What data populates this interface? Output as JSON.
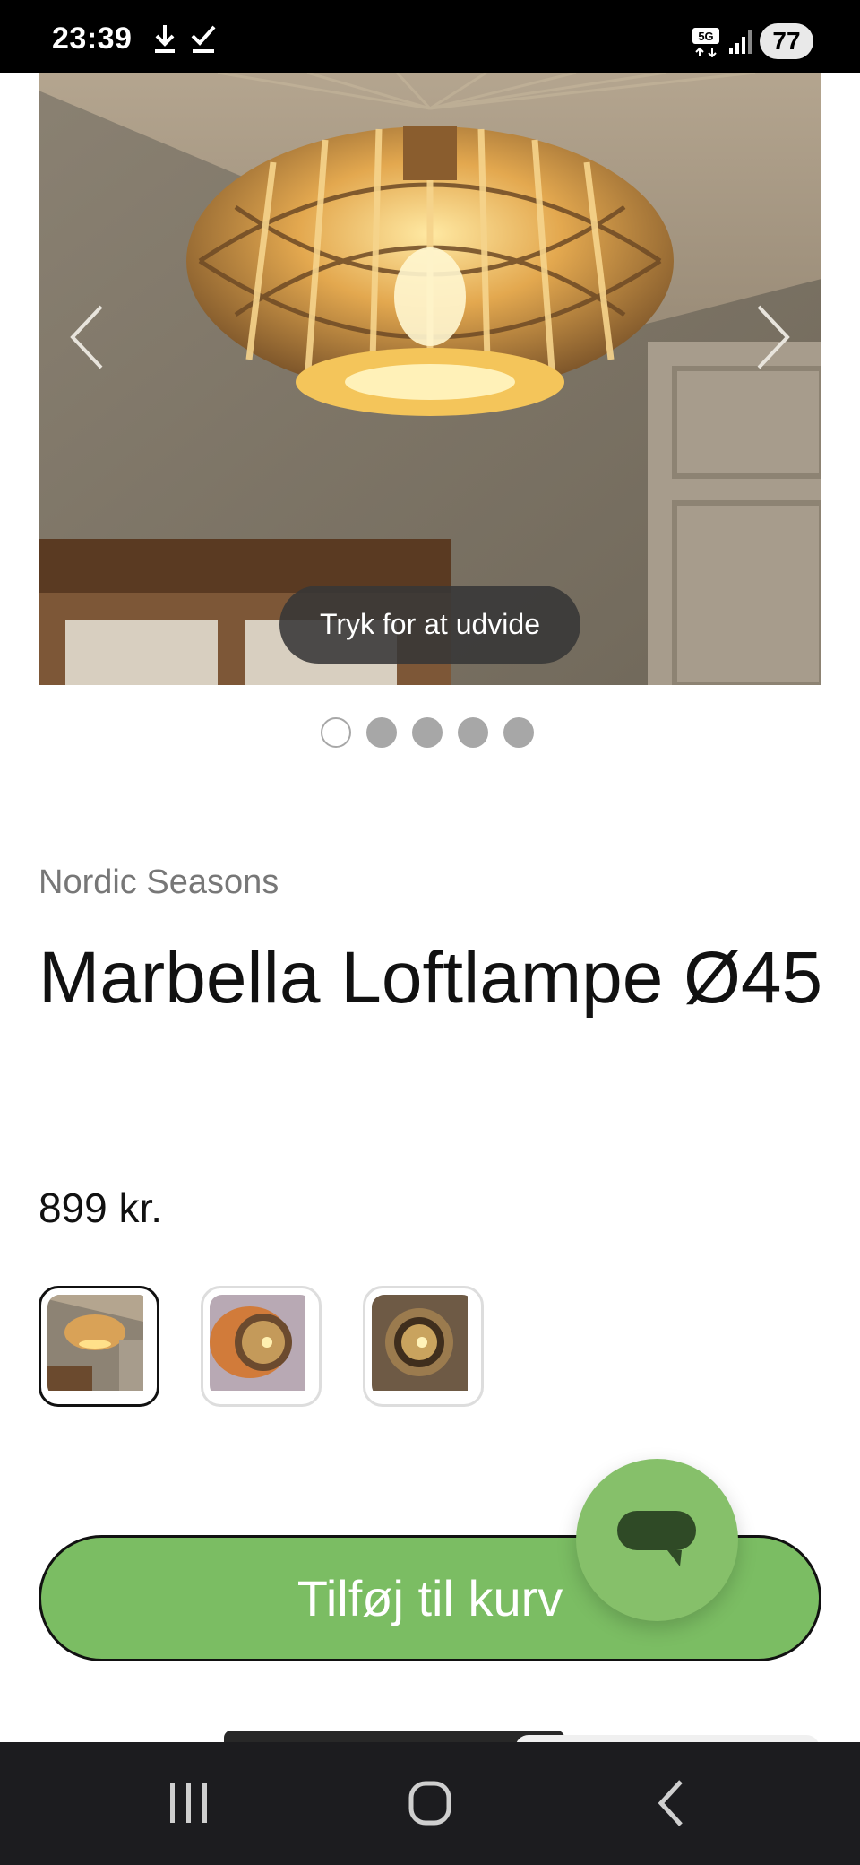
{
  "status_bar": {
    "time": "23:39",
    "network": "5G",
    "battery": "77"
  },
  "gallery": {
    "expand_hint": "Tryk for at udvide",
    "image_count": 5,
    "active_index": 0
  },
  "product": {
    "brand": "Nordic Seasons",
    "title": "Marbella Loftlampe Ø45",
    "price": "899 kr."
  },
  "variants": {
    "count": 3,
    "selected_index": 0
  },
  "cart": {
    "add_label": "Tilføj til kurv"
  },
  "colors": {
    "accent_green": "#7bbd63",
    "chat_green": "#86c06a",
    "chat_icon": "#2f4a26"
  },
  "icons": [
    "download-icon",
    "check-icon",
    "signal-icon",
    "chevron-left-icon",
    "chevron-right-icon",
    "chat-bubble-icon",
    "recents-icon",
    "home-icon",
    "back-icon"
  ]
}
